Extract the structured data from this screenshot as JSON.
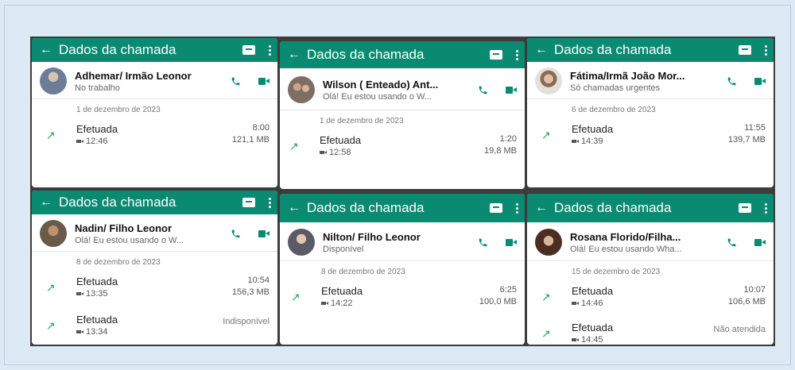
{
  "panels": [
    {
      "header_title": "Dados da chamada",
      "contact_name": "Adhemar/ Irmão Leonor",
      "contact_status": "No trabalho",
      "date": "1 de dezembro de 2023",
      "calls": [
        {
          "type": "Efetuada",
          "time": "12:46",
          "duration": "8:00",
          "size": "121,1 MB"
        }
      ]
    },
    {
      "header_title": "Dados da chamada",
      "contact_name": "Wilson ( Enteado) Ant...",
      "contact_status": "Olá! Eu estou usando o W...",
      "date": "1 de dezembro de 2023",
      "calls": [
        {
          "type": "Efetuada",
          "time": "12:58",
          "duration": "1:20",
          "size": "19,8 MB"
        }
      ]
    },
    {
      "header_title": "Dados da chamada",
      "contact_name": "Fátima/Irmã João Mor...",
      "contact_status": "Só chamadas urgentes",
      "date": "6 de dezembro de 2023",
      "calls": [
        {
          "type": "Efetuada",
          "time": "14:39",
          "duration": "11:55",
          "size": "139,7 MB"
        }
      ]
    },
    {
      "header_title": "Dados da chamada",
      "contact_name": "Nadin/ Filho Leonor",
      "contact_status": "Olá! Eu estou usando o W...",
      "date": "8 de dezembro de 2023",
      "calls": [
        {
          "type": "Efetuada",
          "time": "13:35",
          "duration": "10:54",
          "size": "156,3 MB"
        },
        {
          "type": "Efetuada",
          "time": "13:34",
          "duration": "Indisponível",
          "size": ""
        }
      ]
    },
    {
      "header_title": "Dados da chamada",
      "contact_name": "Nilton/ Filho Leonor",
      "contact_status": "Disponível",
      "date": "8 de dezembro de 2023",
      "calls": [
        {
          "type": "Efetuada",
          "time": "14:22",
          "duration": "6:25",
          "size": "100,0 MB"
        }
      ]
    },
    {
      "header_title": "Dados da chamada",
      "contact_name": "Rosana Florido/Filha...",
      "contact_status": "Olá! Eu estou usando Wha...",
      "date": "15 de dezembro de 2023",
      "calls": [
        {
          "type": "Efetuada",
          "time": "14:46",
          "duration": "10:07",
          "size": "106,6 MB"
        },
        {
          "type": "Efetuada",
          "time": "14:45",
          "duration": "Não atendida",
          "size": ""
        }
      ]
    }
  ],
  "colors": {
    "header": "#0a8a70",
    "accent_green": "#1fa855",
    "background": "#dde9f5"
  },
  "icons": {
    "back": "arrow-left-icon",
    "message": "message-icon",
    "menu": "kebab-menu-icon",
    "phone": "phone-icon",
    "video": "video-call-icon",
    "outgoing": "outgoing-call-arrow-icon",
    "camera": "video-camera-small-icon"
  }
}
